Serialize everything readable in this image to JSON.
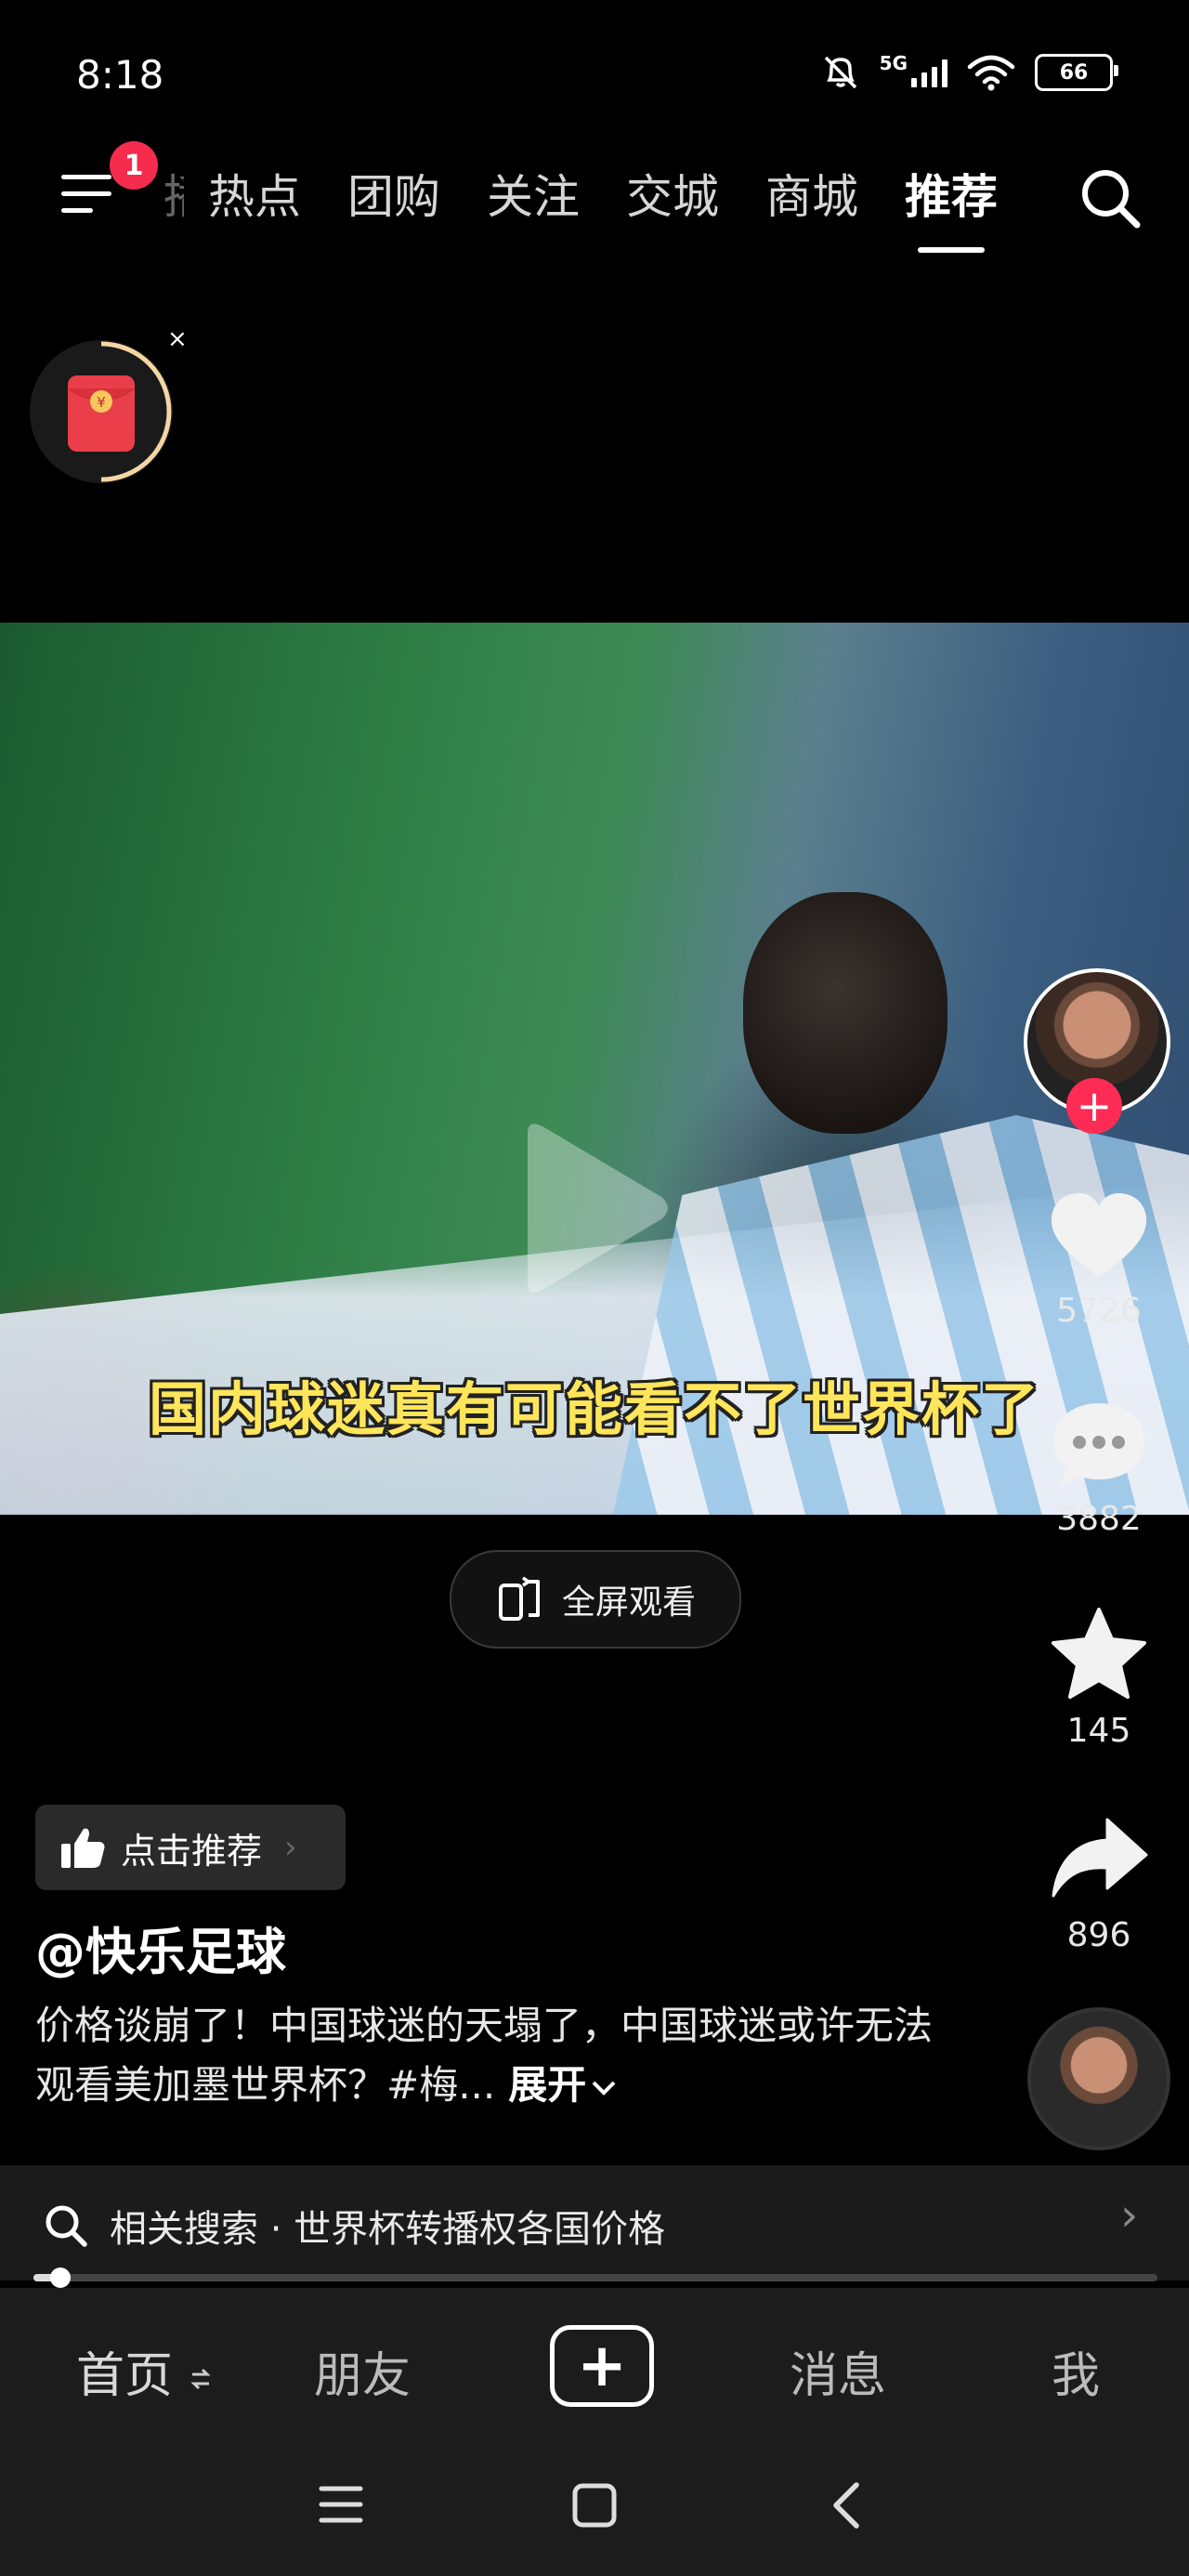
{
  "status_bar": {
    "time": "8:18",
    "network": "5G",
    "battery": "66"
  },
  "top_nav": {
    "menu_badge": "1",
    "faded_tab": "播",
    "tabs": [
      "热点",
      "团购",
      "关注",
      "交城",
      "商城",
      "推荐"
    ],
    "active_tab": "推荐"
  },
  "packet_widget": {
    "close": "×",
    "coin_symbol": "¥"
  },
  "video": {
    "subtitle": "国内球迷真有可能看不了世界杯了"
  },
  "fullscreen": {
    "label": "全屏观看"
  },
  "actions": {
    "likes": "5726",
    "comments": "3882",
    "favorites": "145",
    "shares": "896"
  },
  "post": {
    "recommend_label": "点击推荐",
    "author": "@快乐足球",
    "caption": "价格谈崩了！中国球迷的天塌了，中国球迷或许无法观看美加墨世界杯？#梅...",
    "more": "展开"
  },
  "related_search": {
    "text": "相关搜索 · 世界杯转播权各国价格"
  },
  "progress": {
    "fraction": 0.024
  },
  "bottom_tabs": {
    "home": "首页",
    "friends": "朋友",
    "messages": "消息",
    "me": "我"
  },
  "colors": {
    "accent": "#fe2c55",
    "subtitle": "#ffe55a",
    "background": "#000000"
  }
}
